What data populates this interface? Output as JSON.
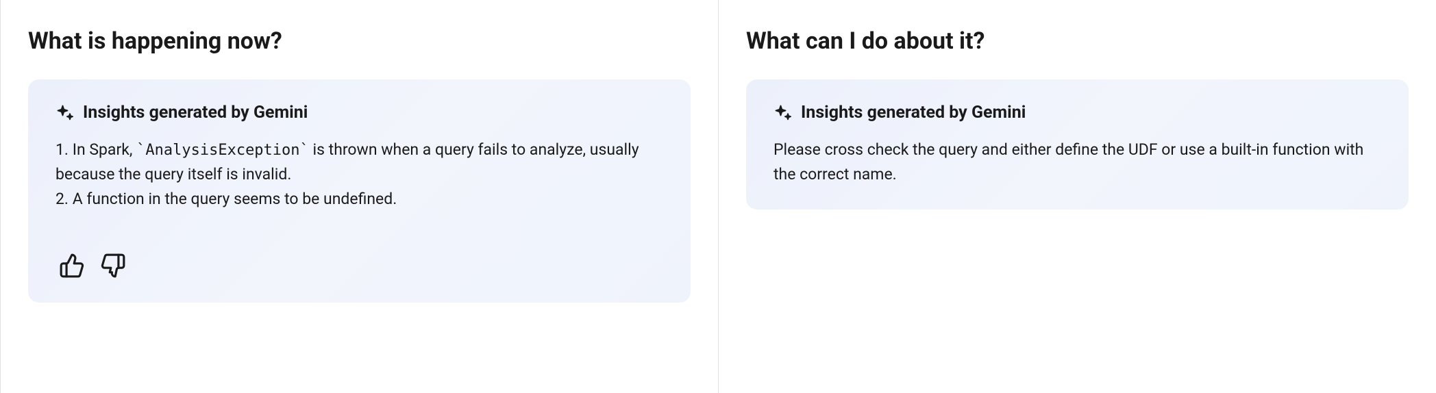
{
  "left": {
    "title": "What is happening now?",
    "card": {
      "header": "Insights generated by Gemini",
      "line1_prefix": "1. In Spark, ",
      "line1_code": "`AnalysisException`",
      "line1_suffix": " is thrown when a query fails to analyze, usually because the query itself is invalid.",
      "line2": "2. A function in the query seems to be undefined."
    }
  },
  "right": {
    "title": "What can I do about it?",
    "card": {
      "header": "Insights generated by Gemini",
      "body": "Please cross check the query and either define the UDF or use a built-in function with the correct name."
    }
  }
}
